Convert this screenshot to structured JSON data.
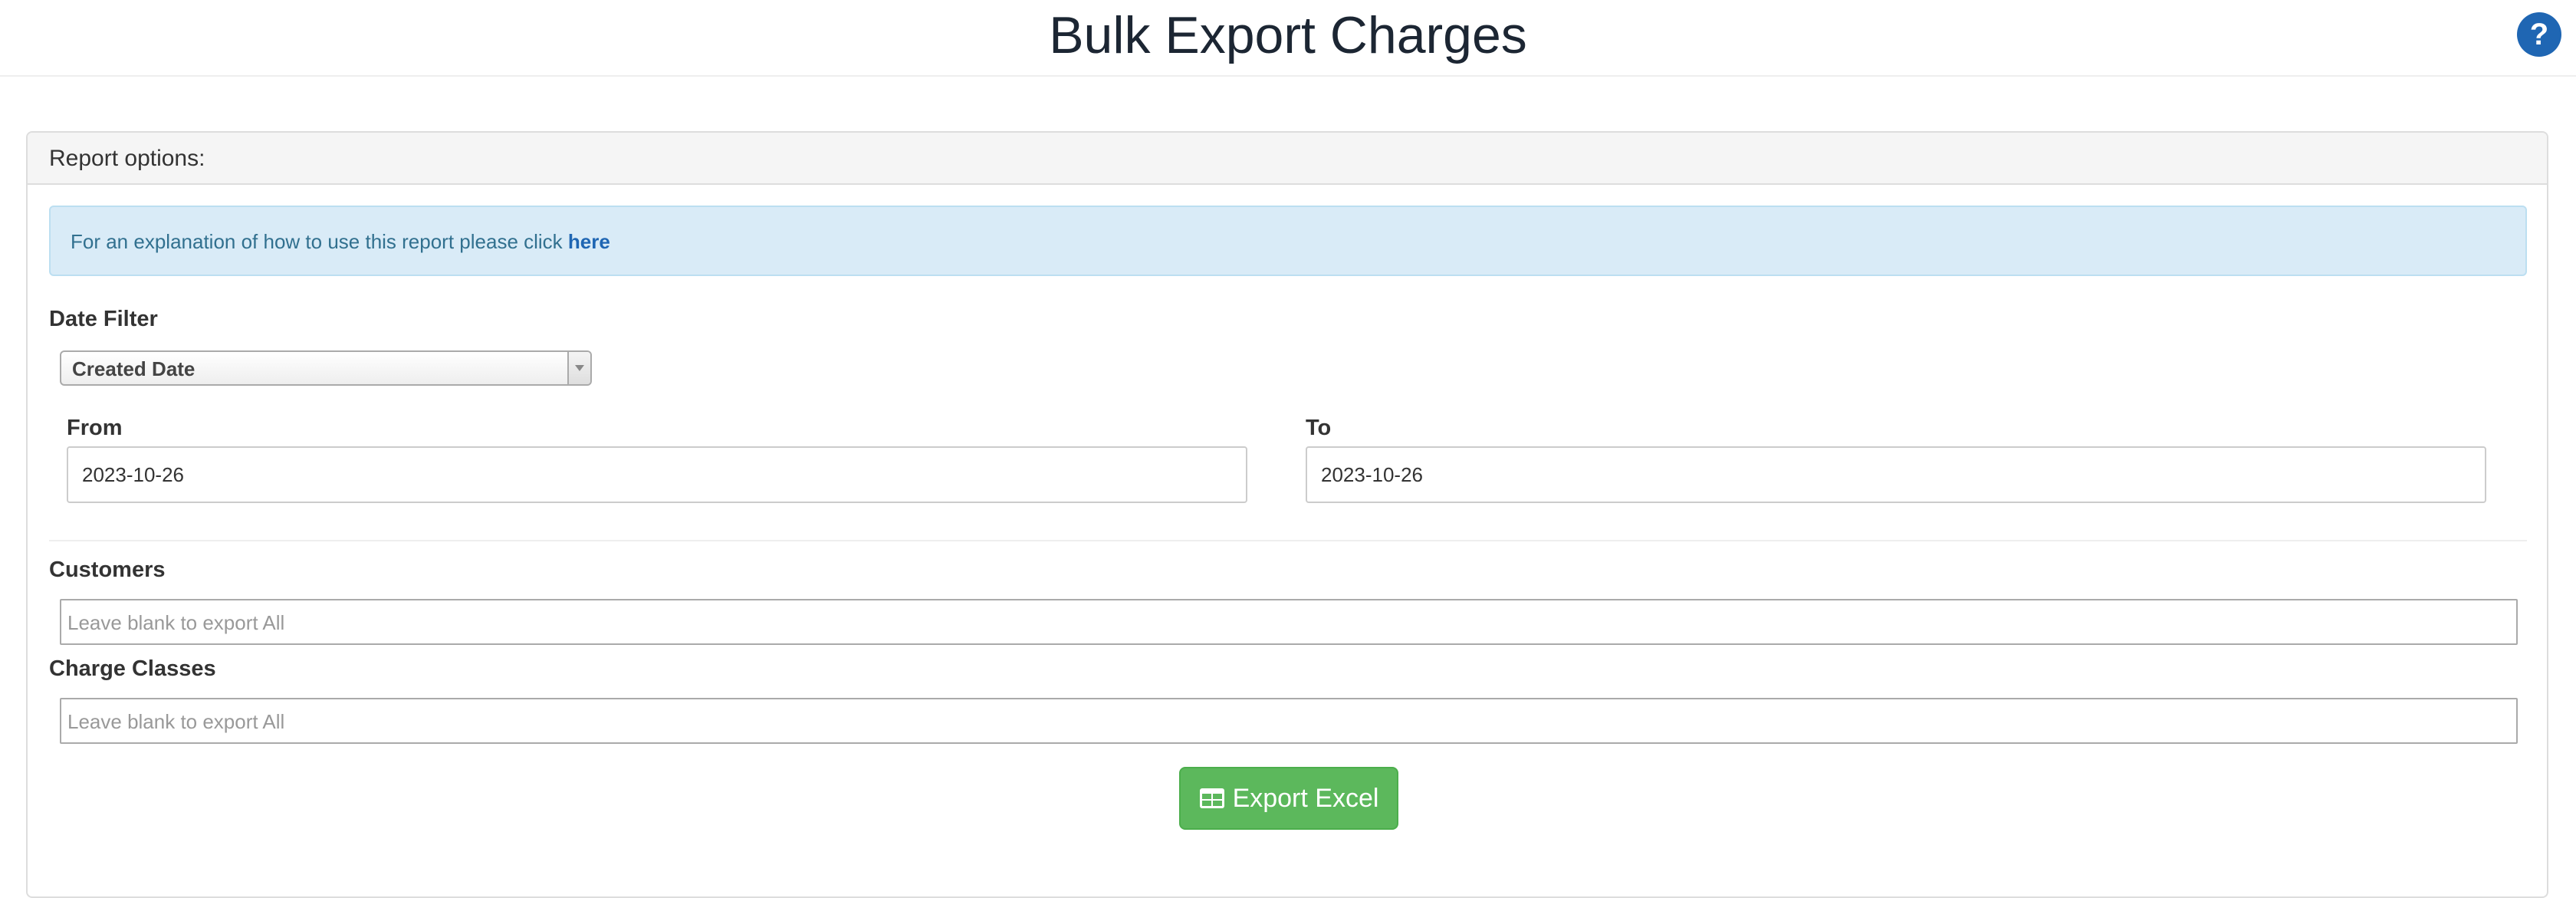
{
  "header": {
    "title": "Bulk Export Charges",
    "help_label": "?"
  },
  "panel": {
    "heading": "Report options:"
  },
  "info": {
    "text": "For an explanation of how to use this report please click ",
    "link_label": "here"
  },
  "date_filter": {
    "label": "Date Filter",
    "selected": "Created Date"
  },
  "from": {
    "label": "From",
    "value": "2023-10-26"
  },
  "to": {
    "label": "To",
    "value": "2023-10-26"
  },
  "customers": {
    "label": "Customers",
    "placeholder": "Leave blank to export All"
  },
  "charge_classes": {
    "label": "Charge Classes",
    "placeholder": "Leave blank to export All"
  },
  "export_button": {
    "label": "Export Excel",
    "icon": "table-icon"
  },
  "colors": {
    "title": "#1c2633",
    "help": "#1f66b3",
    "info_bg": "#d9ebf7",
    "link": "#1f66b3",
    "export": "#5cb85c"
  }
}
